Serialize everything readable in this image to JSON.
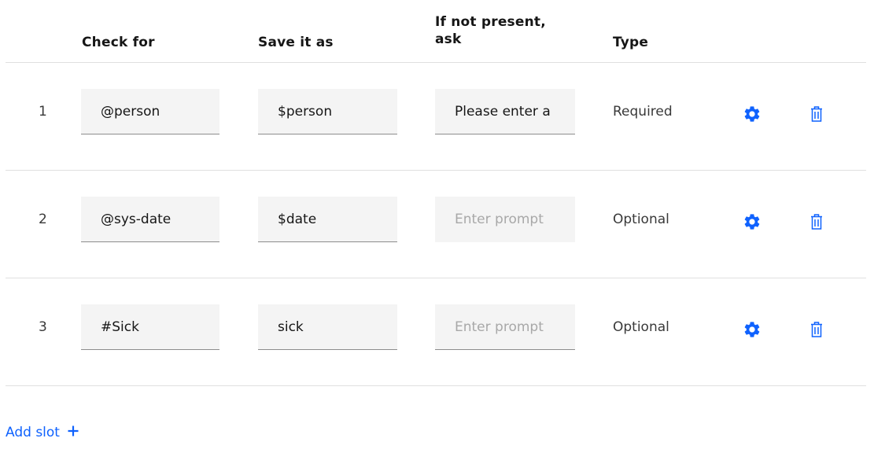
{
  "header": {
    "check_for": "Check for",
    "save_it_as": "Save it as",
    "if_not_present_line1": "If not present,",
    "if_not_present_line2": "ask",
    "type": "Type"
  },
  "rows": [
    {
      "number": "1",
      "check_for": "@person",
      "save_as": "$person",
      "prompt_value": "Please enter a",
      "prompt_placeholder": "Enter prompt",
      "type": "Required"
    },
    {
      "number": "2",
      "check_for": "@sys-date",
      "save_as": "$date",
      "prompt_value": "",
      "prompt_placeholder": "Enter prompt",
      "type": "Optional"
    },
    {
      "number": "3",
      "check_for": "#Sick",
      "save_as": "sick",
      "prompt_value": "",
      "prompt_placeholder": "Enter prompt",
      "type": "Optional"
    }
  ],
  "add_slot_label": "Add slot",
  "icons": {
    "settings": "gear-icon",
    "delete": "trash-icon",
    "add": "plus-icon"
  },
  "colors": {
    "accent": "#0f62fe",
    "field_bg": "#f4f4f4",
    "placeholder": "#a8a8a8",
    "divider": "#e0e0e0"
  }
}
